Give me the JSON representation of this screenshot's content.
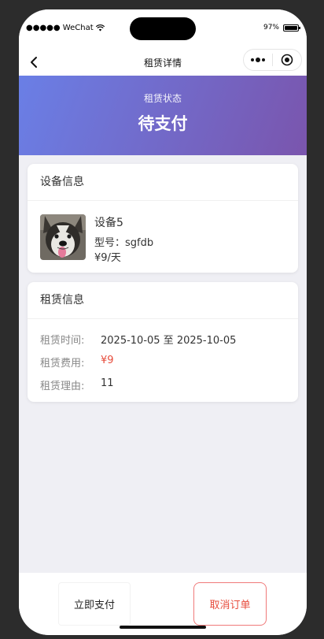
{
  "statusbar": {
    "carrier": "●●●●● WeChat",
    "battery": "97%",
    "battery_level": 0.97
  },
  "navbar": {
    "title": "租赁详情"
  },
  "hero": {
    "label": "租赁状态",
    "status": "待支付",
    "gradient_start": "#6a7fe6",
    "gradient_end": "#7a55ad"
  },
  "device": {
    "section_title": "设备信息",
    "name": "设备5",
    "model": "型号：sgfdb",
    "price": "¥9/天",
    "image": "husky-dog-photo"
  },
  "rental": {
    "section_title": "租赁信息",
    "rows": [
      {
        "key": "租赁时间:",
        "value": "2025-10-05 至 2025-10-05"
      },
      {
        "key": "租赁费用:",
        "value": "¥9"
      },
      {
        "key": "租赁理由:",
        "value": "11"
      }
    ]
  },
  "footer": {
    "pay_label": "立即支付",
    "cancel_label": "取消订单",
    "accent": "#e74c3c"
  }
}
